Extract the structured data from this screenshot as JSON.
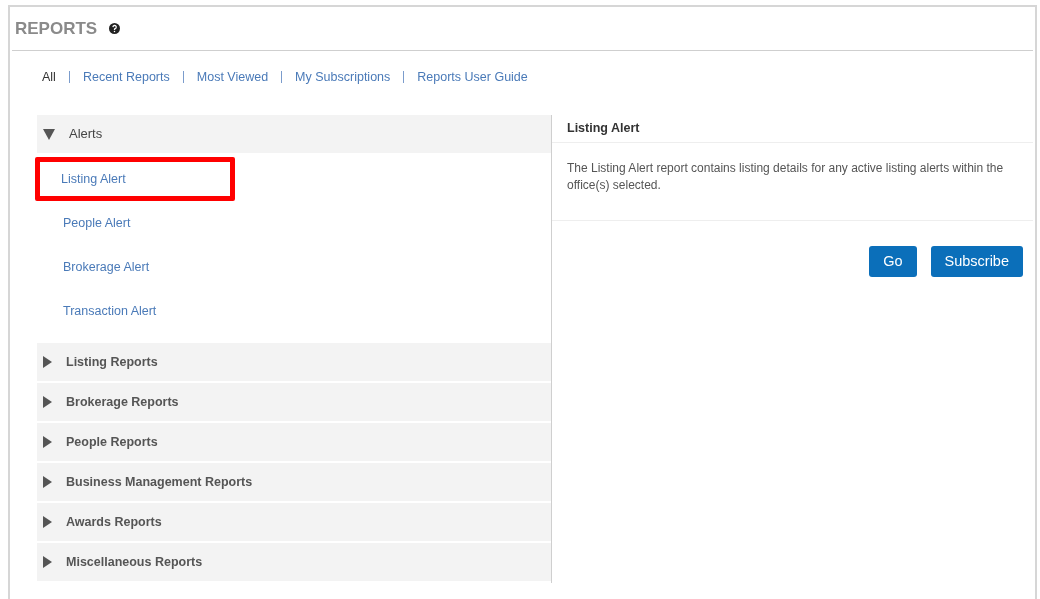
{
  "page": {
    "title": "REPORTS"
  },
  "nav": [
    {
      "label": "All",
      "selected": true
    },
    {
      "label": "Recent Reports",
      "selected": false
    },
    {
      "label": "Most Viewed",
      "selected": false
    },
    {
      "label": "My Subscriptions",
      "selected": false
    },
    {
      "label": "Reports User Guide",
      "selected": false
    }
  ],
  "categories": [
    {
      "label": "Alerts",
      "expanded": true,
      "children": [
        {
          "label": "Listing Alert",
          "highlighted": true
        },
        {
          "label": "People Alert",
          "highlighted": false
        },
        {
          "label": "Brokerage Alert",
          "highlighted": false
        },
        {
          "label": "Transaction Alert",
          "highlighted": false
        }
      ]
    },
    {
      "label": "Listing Reports",
      "expanded": false
    },
    {
      "label": "Brokerage Reports",
      "expanded": false
    },
    {
      "label": "People Reports",
      "expanded": false
    },
    {
      "label": "Business Management Reports",
      "expanded": false
    },
    {
      "label": "Awards Reports",
      "expanded": false
    },
    {
      "label": "Miscellaneous Reports",
      "expanded": false
    }
  ],
  "detail": {
    "title": "Listing Alert",
    "description": "The Listing Alert report contains listing details for any active listing alerts within the office(s) selected.",
    "buttons": [
      "Go",
      "Subscribe"
    ]
  }
}
